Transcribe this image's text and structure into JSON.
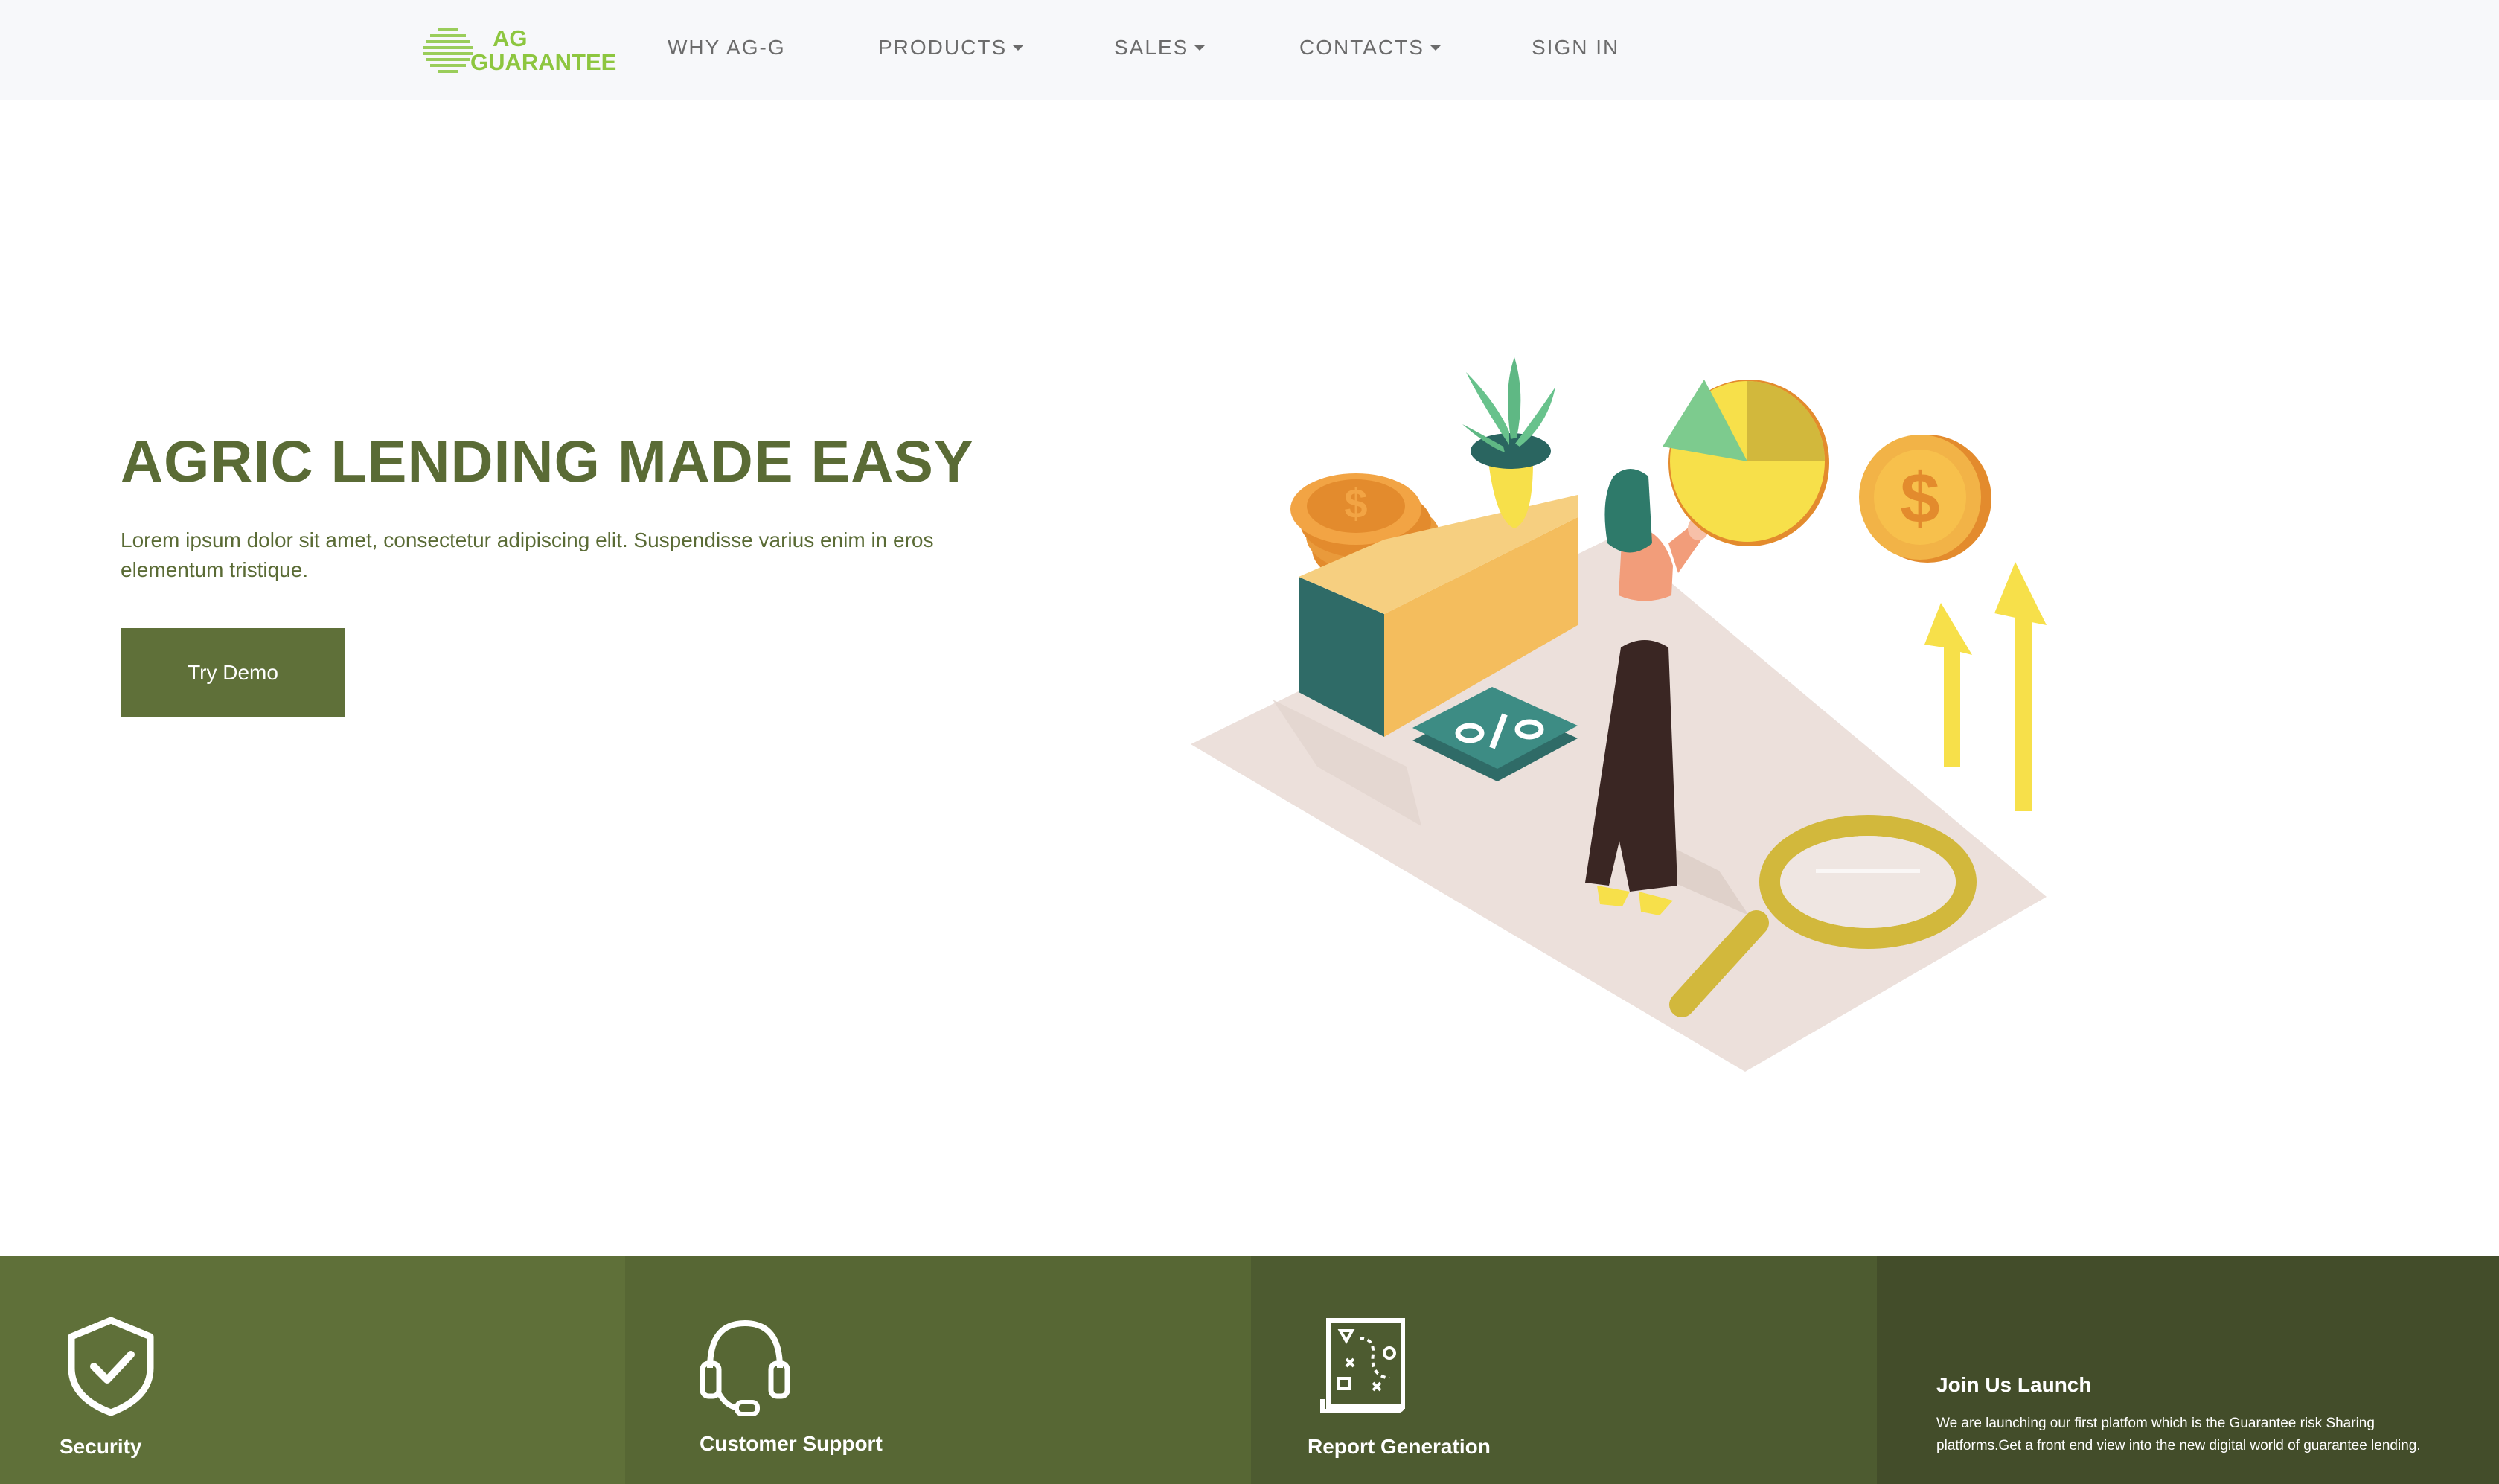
{
  "nav": {
    "logo_line1": "AG",
    "logo_line2": "GUARANTEE",
    "items": [
      {
        "label": "WHY AG-G"
      },
      {
        "label": "PRODUCTS"
      },
      {
        "label": "SALES"
      },
      {
        "label": "CONTACTS"
      },
      {
        "label": "SIGN IN"
      }
    ]
  },
  "hero": {
    "title": "AGRIC LENDING MADE EASY",
    "text": "Lorem ipsum dolor sit amet, consectetur adipiscing elit. Suspendisse varius enim in eros elementum tristique.",
    "button_label": "Try Demo",
    "illustration_icons": [
      "coin-stack-icon",
      "plant-icon",
      "pie-chart-icon",
      "dollar-coin-icon",
      "up-arrow-icon",
      "percent-tile-icon",
      "magnifier-icon",
      "woman-figure-icon"
    ]
  },
  "features": [
    {
      "icon": "shield-check-icon",
      "title": "Security",
      "text": ""
    },
    {
      "icon": "headset-icon",
      "title": "Customer Support",
      "text": ""
    },
    {
      "icon": "report-icon",
      "title": "Report Generation",
      "text": ""
    },
    {
      "icon": "",
      "title": "Join Us Launch",
      "text": "We are launching our first platfom which is the Guarantee risk Sharing platforms.Get a front end view into the new digital world of guarantee lending."
    }
  ],
  "colors": {
    "brand_green": "#5f7039",
    "logo_green": "#8dc63f",
    "nav_bg": "#f7f8fa"
  }
}
